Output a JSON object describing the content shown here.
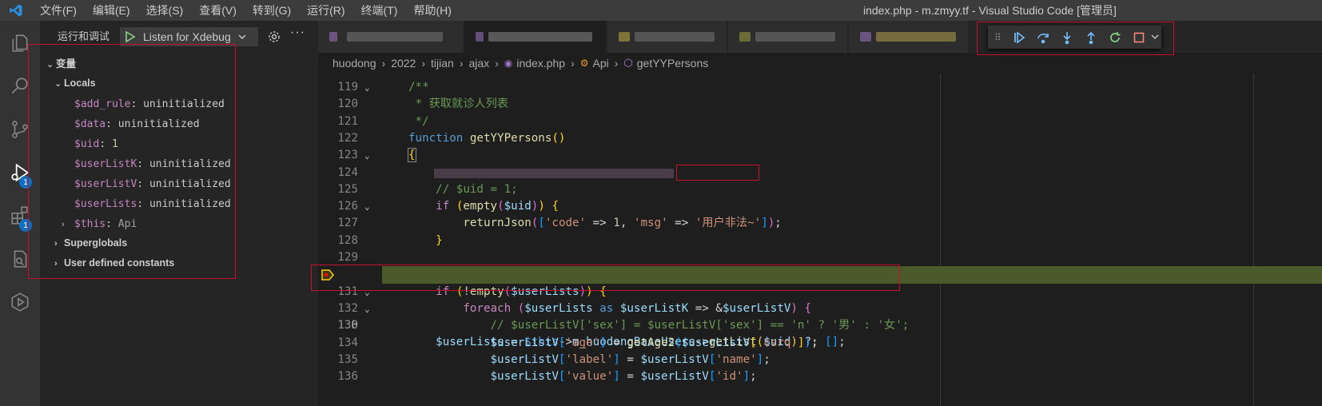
{
  "app": {
    "window_title": "index.php - m.zmyy.tf - Visual Studio Code [管理员]",
    "menu": [
      "文件(F)",
      "编辑(E)",
      "选择(S)",
      "查看(V)",
      "转到(G)",
      "运行(R)",
      "终端(T)",
      "帮助(H)"
    ]
  },
  "activity_bar": {
    "debug_badge": "1",
    "extensions_badge": "1"
  },
  "sidebar": {
    "title": "运行和调试",
    "launch_config": "Listen for Xdebug",
    "variables_header": "变量",
    "locals_header": "Locals",
    "locals": [
      {
        "name": "$add_rule",
        "value": "uninitialized"
      },
      {
        "name": "$data",
        "value": "uninitialized"
      },
      {
        "name": "$uid",
        "value": "1"
      },
      {
        "name": "$userListK",
        "value": "uninitialized"
      },
      {
        "name": "$userListV",
        "value": "uninitialized"
      },
      {
        "name": "$userLists",
        "value": "uninitialized"
      },
      {
        "name": "$this",
        "value": "Api"
      }
    ],
    "superglobals": "Superglobals",
    "user_constants": "User defined constants"
  },
  "breadcrumb": [
    "huodong",
    "2022",
    "tijian",
    "ajax",
    "index.php",
    "Api",
    "getYYPersons"
  ],
  "editor": {
    "highlighted_line": "130",
    "lines": [
      {
        "n": "119",
        "t": "    /**"
      },
      {
        "n": "120",
        "t": "     * 获取就诊人列表"
      },
      {
        "n": "121",
        "t": "     */"
      },
      {
        "n": "122",
        "t": "    function getYYPersons()"
      },
      {
        "n": "123",
        "t": "    {"
      },
      {
        "n": "124",
        "t": ""
      },
      {
        "n": "125",
        "t": "        // $uid = 1;"
      },
      {
        "n": "126",
        "t": "        if (empty($uid)) {"
      },
      {
        "n": "127",
        "t": "            returnJson(['code' => 1, 'msg' => '用户非法~']);"
      },
      {
        "n": "128",
        "t": "        }"
      },
      {
        "n": "129",
        "t": ""
      },
      {
        "n": "130",
        "t": "        $userLists = $this->m_huodongBaseUsers->getList($uid) ?: [];"
      },
      {
        "n": "131",
        "t": "        if (!empty($userLists)) {"
      },
      {
        "n": "132",
        "t": "            foreach ($userLists as $userListK => &$userListV) {"
      },
      {
        "n": "133",
        "t": "                // $userListV['sex'] = $userListV['sex'] == 'n' ? '男' : '女';"
      },
      {
        "n": "134",
        "t": "                $userListV['age'] = getAge2($userListV['csrq']);"
      },
      {
        "n": "135",
        "t": "                $userListV['label'] = $userListV['name'];"
      },
      {
        "n": "136",
        "t": "                $userListV['value'] = $userListV['id'];"
      }
    ]
  },
  "colors": {
    "accent": "#0e70c0",
    "annotation_red": "#c8102e",
    "current_line": "#4b5a2a"
  }
}
